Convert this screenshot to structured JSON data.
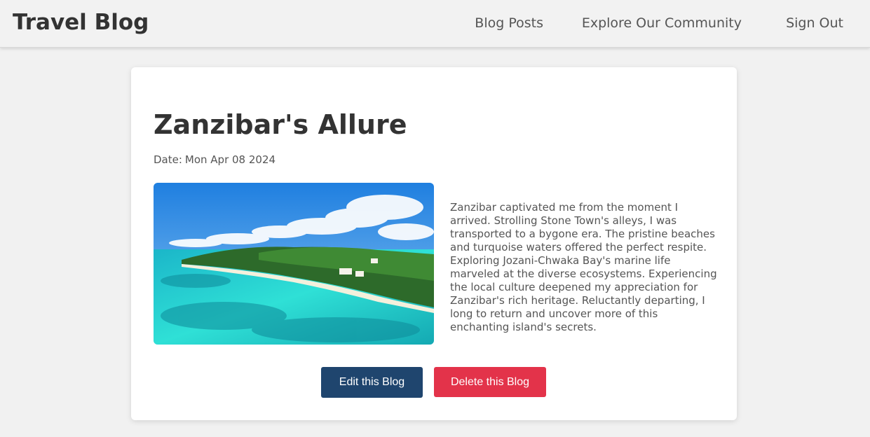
{
  "header": {
    "brand": "Travel Blog",
    "nav": [
      "Blog Posts",
      "Explore Our Community",
      "Sign Out"
    ]
  },
  "post": {
    "title": "Zanzibar's Allure",
    "date_label": "Date:",
    "date": "Mon Apr 08 2024",
    "image_icon": "beach-photo",
    "body": "Zanzibar captivated me from the moment I arrived. Strolling Stone Town's alleys, I was transported to a bygone era. The pristine beaches and turquoise waters offered the perfect respite. Exploring Jozani-Chwaka Bay's marine life marveled at the diverse ecosystems. Experiencing the local culture deepened my appreciation for Zanzibar's rich heritage. Reluctantly departing, I long to return and uncover more of this enchanting island's secrets."
  },
  "actions": {
    "edit_label": "Edit this Blog",
    "delete_label": "Delete this Blog"
  },
  "colors": {
    "edit_button": "#1f456e",
    "delete_button": "#e3334a",
    "background": "#f1f1f1"
  }
}
